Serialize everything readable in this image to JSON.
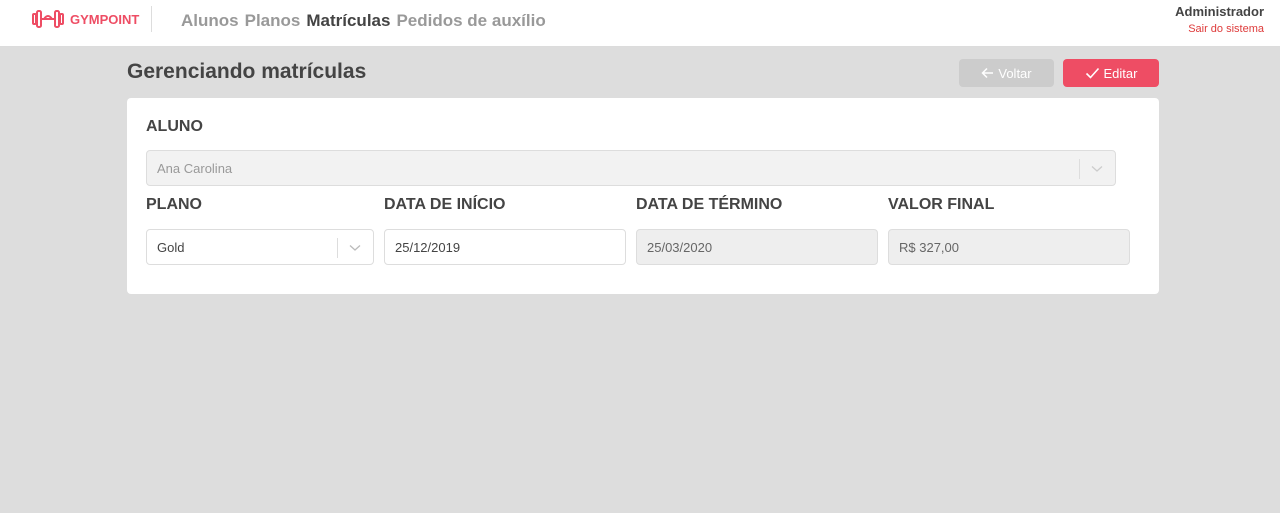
{
  "header": {
    "brand": "GYMPOINT",
    "nav": [
      {
        "label": "Alunos",
        "active": false
      },
      {
        "label": "Planos",
        "active": false
      },
      {
        "label": "Matrículas",
        "active": true
      },
      {
        "label": "Pedidos de auxílio",
        "active": false
      }
    ],
    "user_name": "Administrador",
    "logout_label": "Sair do sistema"
  },
  "page": {
    "title": "Gerenciando matrículas",
    "back_label": "Voltar",
    "edit_label": "Editar"
  },
  "form": {
    "aluno_label": "ALUNO",
    "aluno_value": "Ana Carolina",
    "plano_label": "PLANO",
    "plano_value": "Gold",
    "inicio_label": "DATA DE INÍCIO",
    "inicio_value": "25/12/2019",
    "termino_label": "DATA DE TÉRMINO",
    "termino_value": "25/03/2020",
    "valor_label": "VALOR FINAL",
    "valor_value": "R$ 327,00"
  },
  "colors": {
    "accent": "#ee4d64",
    "background": "#dddddd",
    "back_button": "#cccccc"
  },
  "icons": [
    "dumbbell-icon",
    "arrow-left-icon",
    "check-icon",
    "chevron-down-icon"
  ]
}
